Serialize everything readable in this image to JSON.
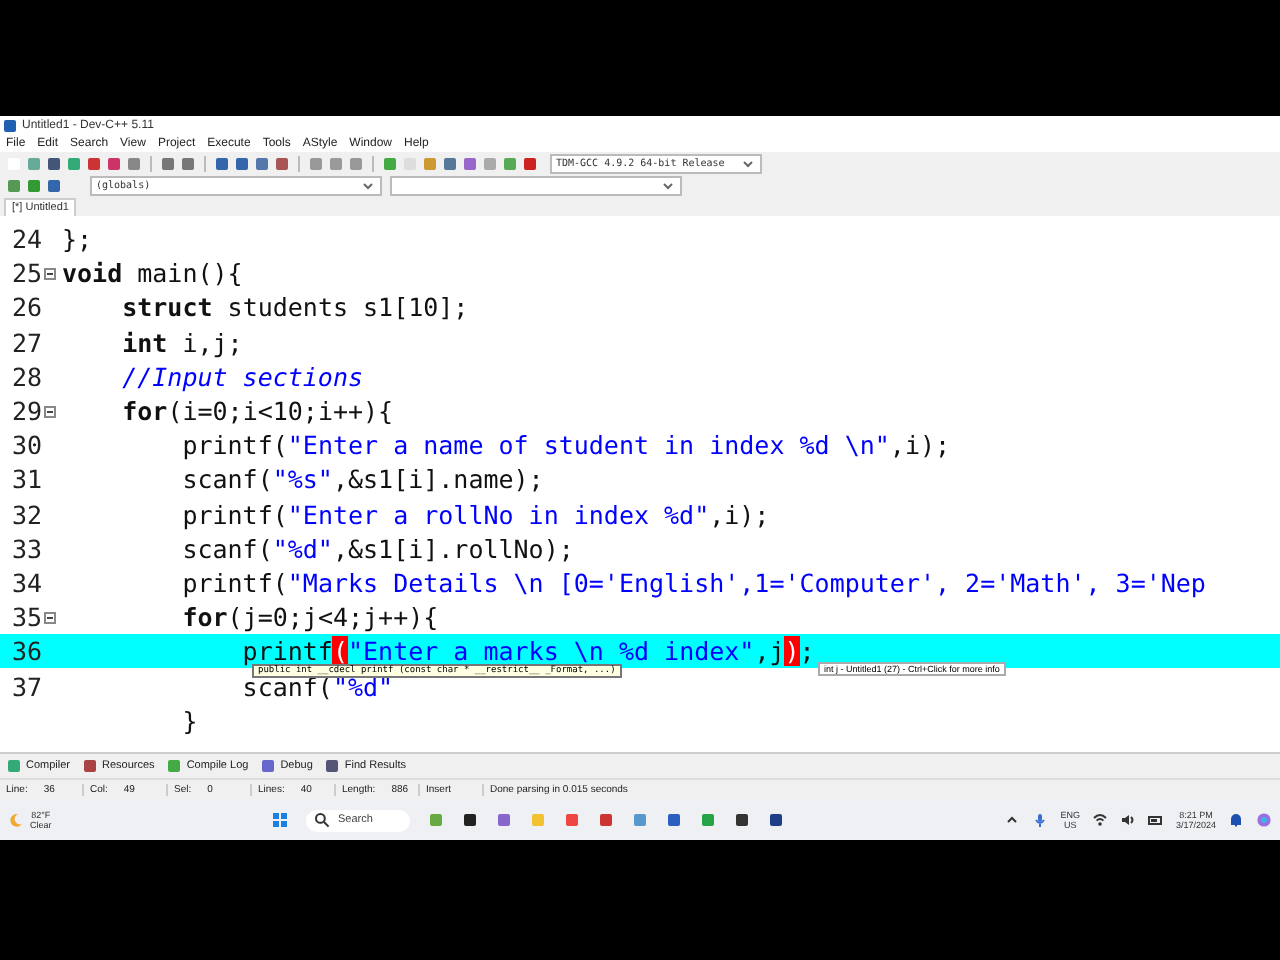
{
  "window": {
    "title": "Untitled1 - Dev-C++ 5.11"
  },
  "menu": [
    "File",
    "Edit",
    "Search",
    "View",
    "Project",
    "Execute",
    "Tools",
    "AStyle",
    "Window",
    "Help"
  ],
  "toolbar": {
    "compiler": "TDM-GCC 4.9.2 64-bit Release",
    "scope": "(globals)"
  },
  "tabs": [
    {
      "label": "[*] Untitled1",
      "selected": true
    }
  ],
  "editor": {
    "lines": [
      {
        "number": "24",
        "fold": false,
        "current": false,
        "tokens": [
          {
            "kind": "plain",
            "text": "};"
          }
        ]
      },
      {
        "number": "25",
        "fold": true,
        "current": false,
        "tokens": [
          {
            "kind": "kw",
            "text": "void"
          },
          {
            "kind": "plain",
            "text": " main(){"
          }
        ]
      },
      {
        "number": "26",
        "fold": false,
        "current": false,
        "tokens": [
          {
            "kind": "kw",
            "text": "    struct"
          },
          {
            "kind": "plain",
            "text": " students s1[10];"
          }
        ]
      },
      {
        "number": "27",
        "fold": false,
        "current": false,
        "tokens": [
          {
            "kind": "kw",
            "text": "    int"
          },
          {
            "kind": "plain",
            "text": " i,j;"
          }
        ]
      },
      {
        "number": "28",
        "fold": false,
        "current": false,
        "tokens": [
          {
            "kind": "cmt",
            "text": "    //Input sections"
          }
        ]
      },
      {
        "number": "29",
        "fold": true,
        "current": false,
        "tokens": [
          {
            "kind": "kw",
            "text": "    for"
          },
          {
            "kind": "plain",
            "text": "(i=0;i<10;i++){"
          }
        ]
      },
      {
        "number": "30",
        "fold": false,
        "current": false,
        "tokens": [
          {
            "kind": "plain",
            "text": "        printf("
          },
          {
            "kind": "str",
            "text": "\"Enter a name of student in index %d \\n\""
          },
          {
            "kind": "plain",
            "text": ",i);"
          }
        ]
      },
      {
        "number": "31",
        "fold": false,
        "current": false,
        "tokens": [
          {
            "kind": "plain",
            "text": "        scanf("
          },
          {
            "kind": "str",
            "text": "\"%s\""
          },
          {
            "kind": "plain",
            "text": ",&s1[i].name);"
          }
        ]
      },
      {
        "number": "32",
        "fold": false,
        "current": false,
        "tokens": [
          {
            "kind": "plain",
            "text": "        printf("
          },
          {
            "kind": "str",
            "text": "\"Enter a rollNo in index %d\""
          },
          {
            "kind": "plain",
            "text": ",i);"
          }
        ]
      },
      {
        "number": "33",
        "fold": false,
        "current": false,
        "tokens": [
          {
            "kind": "plain",
            "text": "        scanf("
          },
          {
            "kind": "str",
            "text": "\"%d\""
          },
          {
            "kind": "plain",
            "text": ",&s1[i].rollNo);"
          }
        ]
      },
      {
        "number": "34",
        "fold": false,
        "current": false,
        "tokens": [
          {
            "kind": "plain",
            "text": "        printf("
          },
          {
            "kind": "str",
            "text": "\"Marks Details \\n [0='English',1='Computer', 2='Math', 3='Nep"
          }
        ]
      },
      {
        "number": "35",
        "fold": true,
        "current": false,
        "tokens": [
          {
            "kind": "kw",
            "text": "        for"
          },
          {
            "kind": "plain",
            "text": "(j=0;j<4;j++){"
          }
        ]
      },
      {
        "number": "36",
        "fold": false,
        "current": true,
        "tokens": [
          {
            "kind": "plain",
            "text": "            printf"
          },
          {
            "kind": "match",
            "text": "("
          },
          {
            "kind": "str",
            "text": "\"Enter a marks \\n %d index\""
          },
          {
            "kind": "plain",
            "text": ",j"
          },
          {
            "kind": "match",
            "text": ")"
          },
          {
            "kind": "plain",
            "text": ";"
          }
        ]
      },
      {
        "number": "37",
        "fold": false,
        "current": false,
        "tokens": [
          {
            "kind": "plain",
            "text": "            scanf("
          },
          {
            "kind": "str",
            "text": "\"%d\""
          }
        ]
      },
      {
        "fold": false,
        "current": false,
        "tokens": [
          {
            "kind": "plain",
            "text": "        }"
          }
        ]
      }
    ],
    "hint": "public int __cdecl printf (const char * __restrict__ _Format, ...)",
    "info": "int j - Untitled1 (27) - Ctrl+Click for more info"
  },
  "bottom_tabs": [
    "Compiler",
    "Resources",
    "Compile Log",
    "Debug",
    "Find Results"
  ],
  "status_bar": [
    {
      "label": "Line:",
      "value": "36"
    },
    {
      "label": "Col:",
      "value": "49"
    },
    {
      "label": "Sel:",
      "value": "0"
    },
    {
      "label": "Lines:",
      "value": "40"
    },
    {
      "label": "Length:",
      "value": "886"
    }
  ],
  "status_mode": "Insert",
  "status_message": "Done parsing in 0.015 seconds",
  "taskbar": {
    "temperature": "82°F",
    "weather": "Clear",
    "search": "Search",
    "lang": "ENG",
    "region": "US",
    "time": "8:21 PM",
    "date": "3/17/2024"
  }
}
